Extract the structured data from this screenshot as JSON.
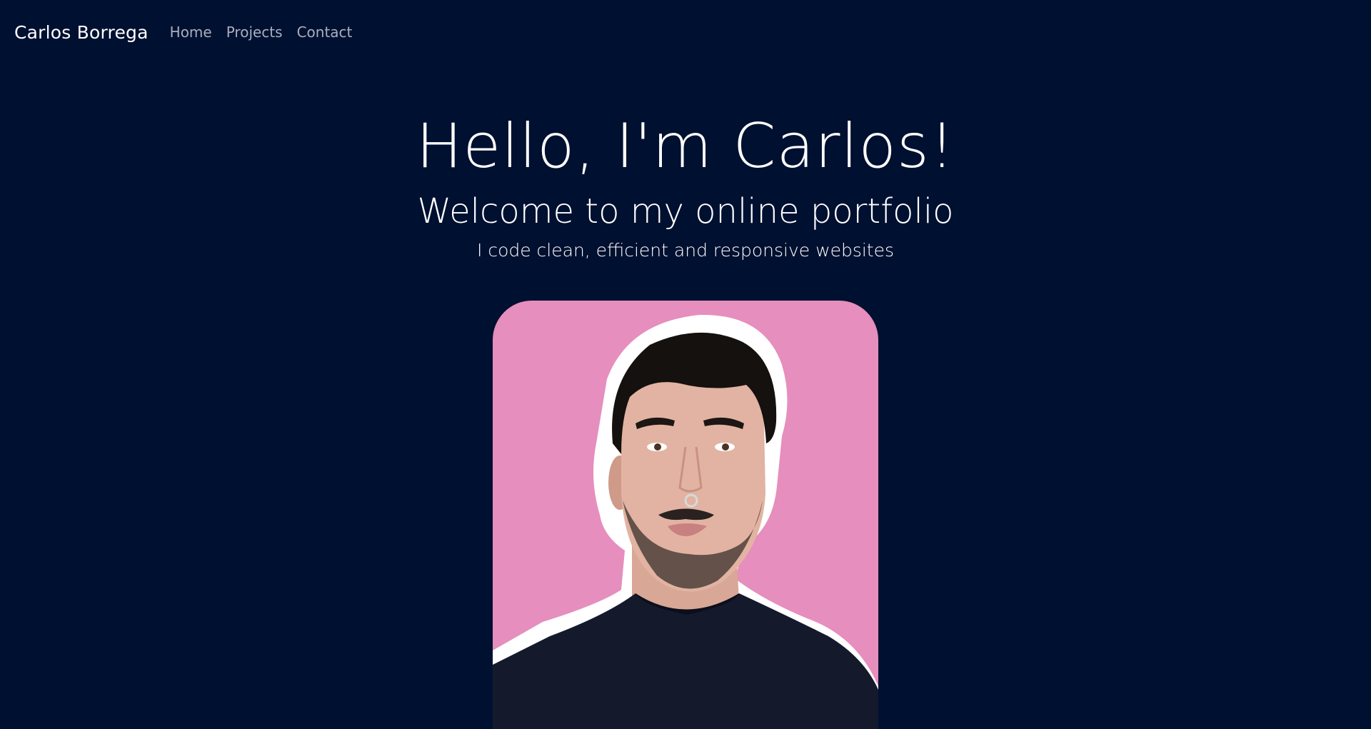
{
  "nav": {
    "brand": "Carlos Borrega",
    "links": [
      "Home",
      "Projects",
      "Contact"
    ]
  },
  "hero": {
    "title": "Hello, I'm Carlos!",
    "subtitle": "Welcome to my online portfolio",
    "tagline": "I code clean, efficient and responsive websites"
  },
  "colors": {
    "background": "#001030",
    "portrait_bg": "#e68ebd",
    "nav_link": "#a9afbf",
    "text": "#ffffff"
  },
  "image": {
    "icon": "portrait-photo"
  }
}
